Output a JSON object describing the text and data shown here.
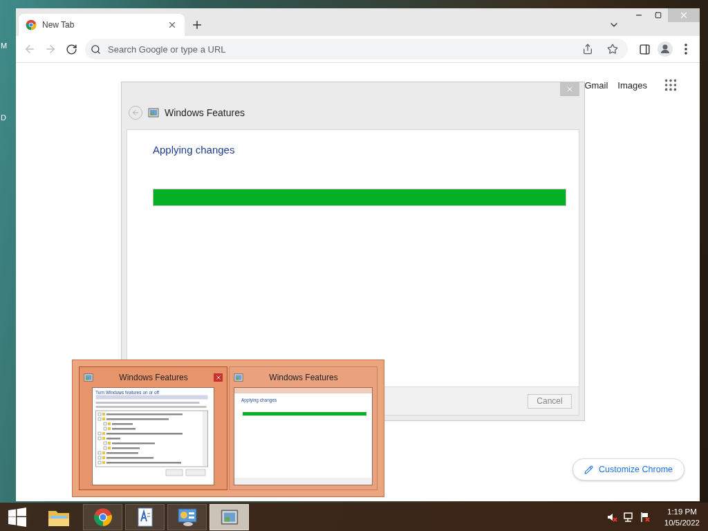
{
  "desktop": {
    "icon_labels": [
      "M",
      "D"
    ]
  },
  "browser": {
    "tabs": [
      {
        "title": "New Tab",
        "selected": true
      }
    ],
    "back": {
      "disabled": true
    },
    "forward": {
      "disabled": true
    },
    "address_bar": {
      "placeholder": "Search Google or type a URL"
    },
    "page_links": [
      "Gmail",
      "Images"
    ],
    "customize_button": "Customize Chrome"
  },
  "dialog": {
    "title": "Windows Features",
    "heading": "Applying changes",
    "progress": {
      "level": 1
    },
    "cancel": {
      "label": "Cancel",
      "disabled": true
    }
  },
  "taskbar_preview": {
    "thumbnails": [
      {
        "title": "Windows Features",
        "kind": "features_list",
        "hovered": true,
        "heading": "Turn Windows features on or off"
      },
      {
        "title": "Windows Features",
        "kind": "progress",
        "hovered": false,
        "heading": "Applying changes",
        "progress": {
          "level": 1
        }
      }
    ]
  },
  "taskbar": {
    "apps": [
      {
        "kind": "explorer",
        "selected": false
      },
      {
        "kind": "chrome",
        "selected": false
      },
      {
        "kind": "document",
        "selected": false
      },
      {
        "kind": "control_panel",
        "selected": false
      },
      {
        "kind": "features",
        "selected": true
      }
    ],
    "tray": [
      {
        "kind": "volume_muted"
      },
      {
        "kind": "network"
      },
      {
        "kind": "flag"
      }
    ],
    "clock": {
      "time": "1:19 PM",
      "date": "10/5/2022"
    }
  }
}
